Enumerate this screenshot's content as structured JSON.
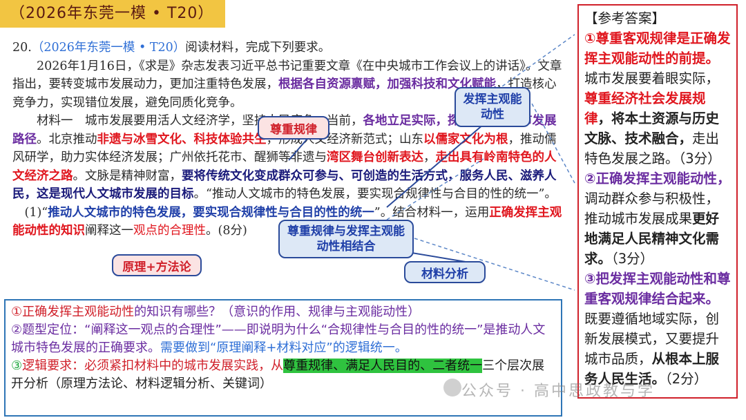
{
  "banner": {
    "title": "（2026年东莞一模 • T20）"
  },
  "question": {
    "number": "20.",
    "source": "（2026年东莞一模 • T20）",
    "instruction": "阅读材料，完成下列要求。",
    "p1_a": "2026年1月16日，《求是》杂志发表习近平总书记重要文章《在中央城市工作会议上的讲话》。文章指出，要转变城市发展动力，更加注重特色发展，",
    "p1_b": "根据各自资源禀赋，加强科技和文化赋能",
    "p1_c": "，打造核心竞争力，实现错位发展，避免同质化竞争。",
    "m1_a": "材料一　城市发展要用活人文经济学，坚持人民底色。当前，",
    "m1_b": "各地立足实际，探索现代化城市发展路径",
    "m1_c": "。北京推动",
    "m1_d": "非遗与冰雪文化、科技体验共生",
    "m1_e": "，形成人文经济新范式；山东",
    "m1_f": "以儒家文化为根",
    "m1_g": "，推动儒风研学，助力实体经济发展；广州依托花市、醒狮等非遗与",
    "m1_h": "湾区舞台创新表达",
    "m1_i": "，",
    "m1_j": "走出具有岭南特色的人文经济之路",
    "m1_k": "。文脉是精神财富，",
    "m1_l": "要将传统文化变成群众可参与、可创造的生活方式，服务人民、滋养人民，这是现代人文城市发展的目标",
    "m1_m": "。“推动人文城市的特色发展，要实现合规律性与合目的性的统一”。",
    "q1_a": "(1)“",
    "q1_b": "推动人文城市的特色发展，要实现合规律性与合目的性的统一",
    "q1_c": "”。结合材料一，运用",
    "q1_d": "正确发挥主观能动性的知识",
    "q1_e": "阐释这一",
    "q1_f": "观点的合理性",
    "q1_g": "。(8分)"
  },
  "callouts": {
    "respect_law": "尊重规律",
    "play_initiative": "发挥主观能动性",
    "combine": "尊重规律与发挥主观能动性相结合",
    "principle_method": "原理+方法论",
    "material_analysis": "材料分析"
  },
  "watermark": {
    "text": "公众号 · 高中思政教与学"
  },
  "answer": {
    "header": "【参考答案】",
    "a1_r1": "①尊重客观规律是正确发挥主观能动性的前提。",
    "a1_n1": "城市发展要着眼实际，",
    "a1_r2": "尊重经济社会发展规律",
    "a1_k1": "，将本土资源与历史文脉、技术融合，",
    "a1_n2": "走出特色发展之路。（3分）",
    "a2_p1": "②正确发挥主观能动性，",
    "a2_n1": "调动群众参与积极性，推动城市发展成果",
    "a2_k1": "更好地满足人民精神文化需求。",
    "a2_n2": "（3分）",
    "a3_p1": "③把发挥主观能动性和尊重客观规律结合起来。",
    "a3_n1": "既要遵循地域实际，创新发展模式，又要提升城市品质，",
    "a3_k1": "从根本上服务人民生活。",
    "a3_n2": "（2分）"
  },
  "analysis": {
    "l1_a": "①",
    "l1_b": "正确发挥主观能动性",
    "l1_c": "的知识有哪些？（意识的作用、规律与主观能动性）",
    "l2_a": "②题型定位：“阐释这一观点的合理性”——即说明为什么“合规律性与合目的性的统一”是推动人文城市特色发展的正确要求。",
    "l2_b": "需要做到“原理阐释+材料对应”的逻辑统一。",
    "l3_a": "③",
    "l3_b": "逻辑要求：必须紧扣材料中的城市发展实践，从",
    "l3_c": "尊重规律、满足人民目的、二者统一",
    "l3_d": "三个层次展开分析（原理方法论、材料逻辑分析、关键词）"
  }
}
